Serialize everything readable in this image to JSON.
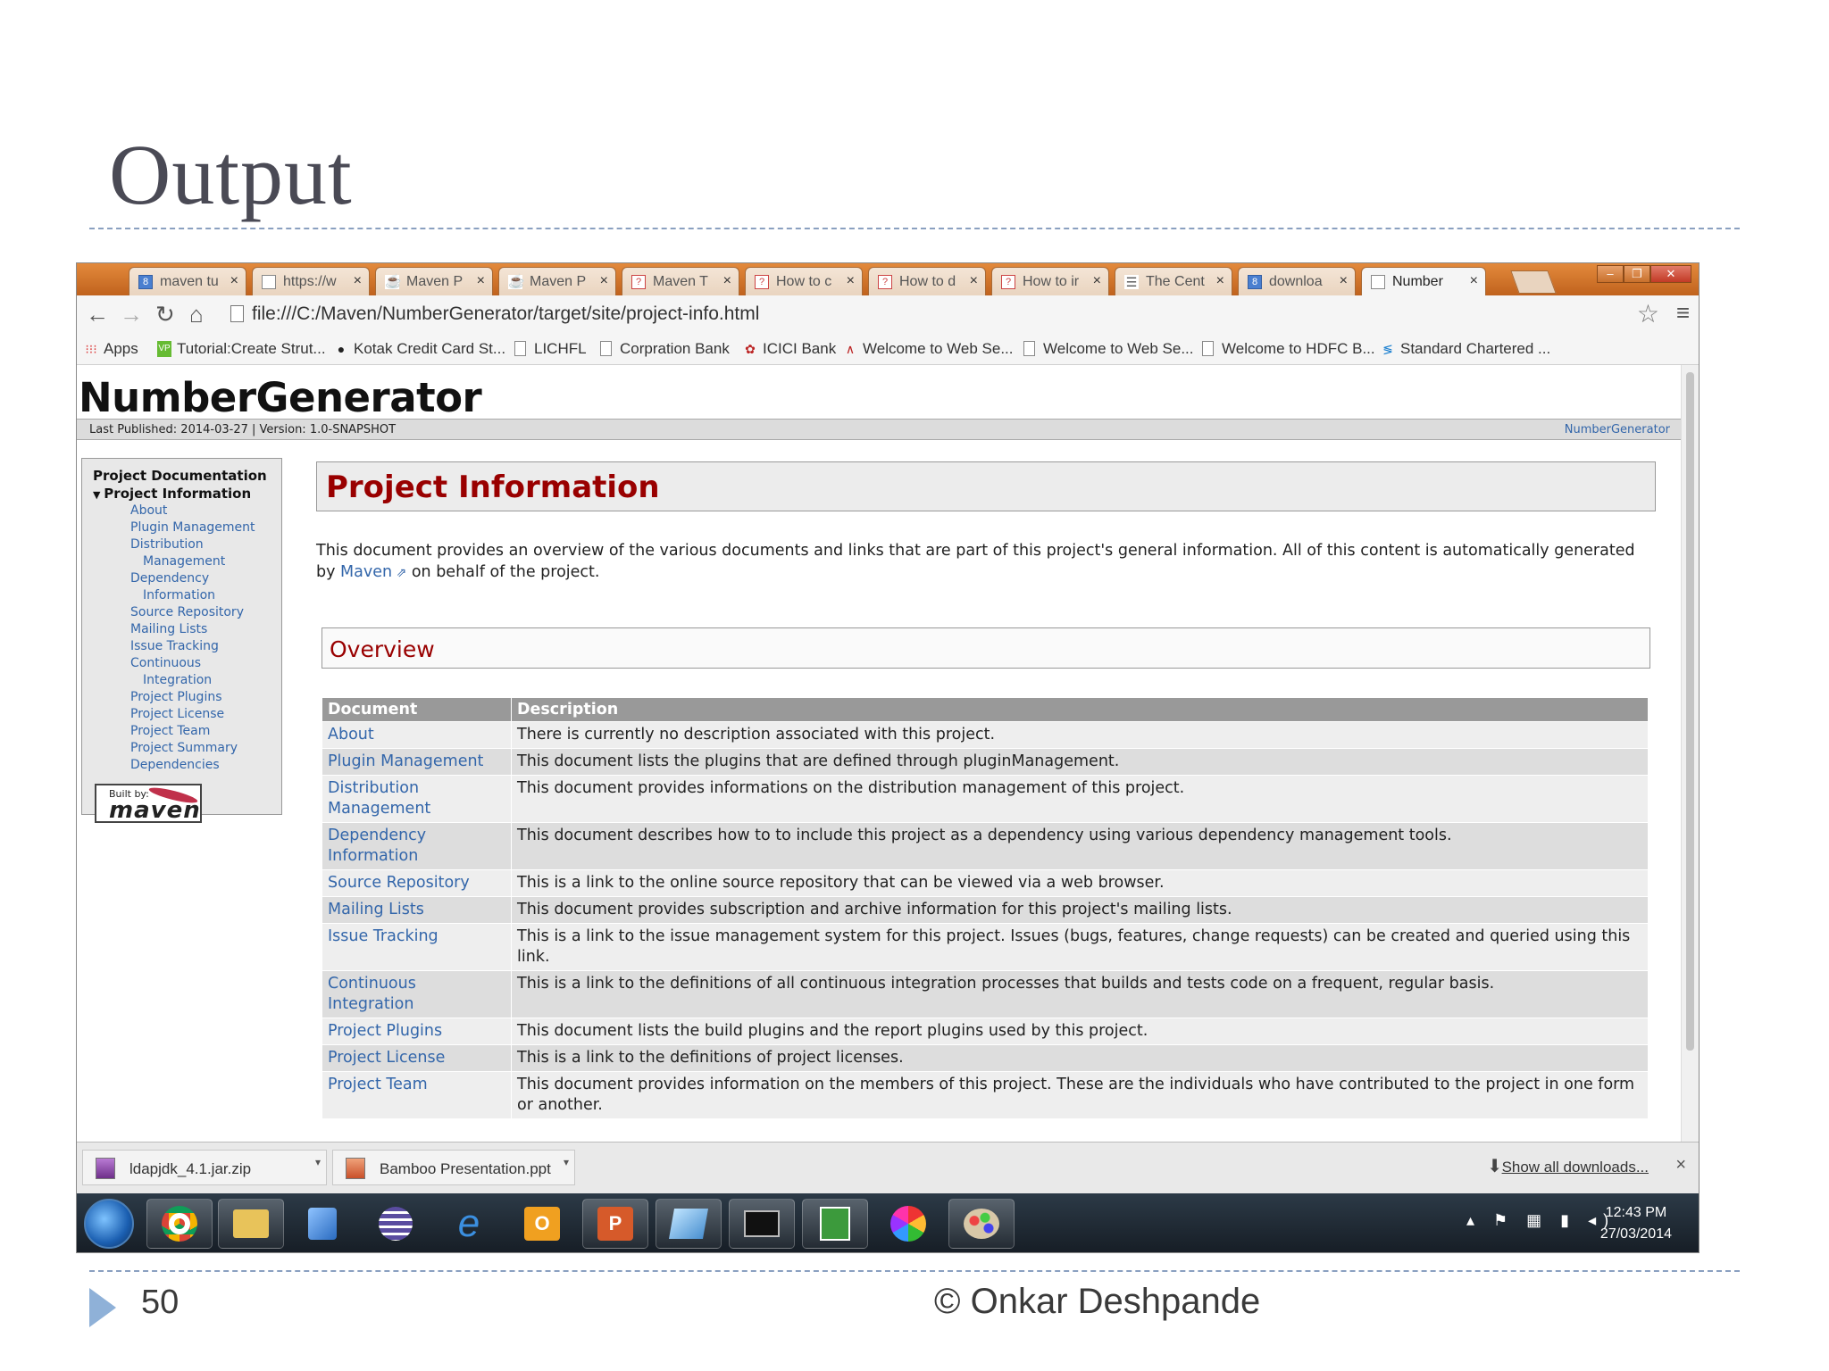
{
  "slide": {
    "title": "Output",
    "page_number": "50",
    "credit": "© Onkar Deshpande"
  },
  "browser": {
    "tabs": [
      {
        "label": "maven tu",
        "icon": "google-icon"
      },
      {
        "label": "https://w",
        "icon": "page-icon"
      },
      {
        "label": "Maven P",
        "icon": "java-icon"
      },
      {
        "label": "Maven P",
        "icon": "java-icon"
      },
      {
        "label": "Maven T",
        "icon": "question-icon"
      },
      {
        "label": "How to c",
        "icon": "question-icon"
      },
      {
        "label": "How to d",
        "icon": "question-icon"
      },
      {
        "label": "How to ir",
        "icon": "question-icon"
      },
      {
        "label": "The Cent",
        "icon": "list-icon"
      },
      {
        "label": "downloa",
        "icon": "google-icon"
      },
      {
        "label": "Number",
        "icon": "page-icon",
        "active": true
      }
    ],
    "address": "file:///C:/Maven/NumberGenerator/target/site/project-info.html",
    "bookmarks": [
      {
        "label": "Apps",
        "icon": "apps-icon"
      },
      {
        "label": "Tutorial:Create Strut...",
        "icon": "vp-icon"
      },
      {
        "label": "Kotak Credit Card St...",
        "icon": "kotak-icon"
      },
      {
        "label": "LICHFL",
        "icon": "page-icon"
      },
      {
        "label": "Corpration Bank",
        "icon": "page-icon"
      },
      {
        "label": "ICICI Bank",
        "icon": "icici-icon"
      },
      {
        "label": "Welcome to Web Se...",
        "icon": "arch-icon"
      },
      {
        "label": "Welcome to Web Se...",
        "icon": "page-icon"
      },
      {
        "label": "Welcome to HDFC B...",
        "icon": "page-icon"
      },
      {
        "label": "Standard Chartered ...",
        "icon": "sc-icon"
      }
    ]
  },
  "site": {
    "name": "NumberGenerator",
    "published": "Last Published: 2014-03-27  | Version: 1.0-SNAPSHOT",
    "breadcrumb_right": "NumberGenerator",
    "menu_heading": "Project Documentation",
    "menu_sub": "Project Information",
    "menu_items": [
      "About",
      "Plugin Management",
      "Distribution",
      "Management",
      "Dependency",
      "Information",
      "Source Repository",
      "Mailing Lists",
      "Issue Tracking",
      "Continuous",
      "Integration",
      "Project Plugins",
      "Project License",
      "Project Team",
      "Project Summary",
      "Dependencies"
    ],
    "built_by_small": "Built by:",
    "built_by_word": "maven",
    "heading": "Project Information",
    "intro_before": "This document provides an overview of the various documents and links that are part of this project's general information. All of this content is automatically generated by ",
    "intro_link": "Maven",
    "intro_after": " on behalf of the project.",
    "overview": "Overview",
    "table_headers": [
      "Document",
      "Description"
    ],
    "table_rows": [
      {
        "doc": "About",
        "desc": "There is currently no description associated with this project."
      },
      {
        "doc": "Plugin Management",
        "desc": "This document lists the plugins that are defined through pluginManagement."
      },
      {
        "doc": "Distribution Management",
        "desc": "This document provides informations on the distribution management of this project."
      },
      {
        "doc": "Dependency Information",
        "desc": "This document describes how to to include this project as a dependency using various dependency management tools."
      },
      {
        "doc": "Source Repository",
        "desc": "This is a link to the online source repository that can be viewed via a web browser."
      },
      {
        "doc": "Mailing Lists",
        "desc": "This document provides subscription and archive information for this project's mailing lists."
      },
      {
        "doc": "Issue Tracking",
        "desc": "This is a link to the issue management system for this project. Issues (bugs, features, change requests) can be created and queried using this link."
      },
      {
        "doc": "Continuous Integration",
        "desc": "This is a link to the definitions of all continuous integration processes that builds and tests code on a frequent, regular basis."
      },
      {
        "doc": "Project Plugins",
        "desc": "This document lists the build plugins and the report plugins used by this project."
      },
      {
        "doc": "Project License",
        "desc": "This is a link to the definitions of project licenses."
      },
      {
        "doc": "Project Team",
        "desc": "This document provides information on the members of this project. These are the individuals who have contributed to the project in one form or another."
      }
    ]
  },
  "downloads": {
    "items": [
      "ldapjdk_4.1.jar.zip",
      "Bamboo Presentation.ppt"
    ],
    "show_all": "Show all downloads..."
  },
  "taskbar": {
    "time": "12:43 PM",
    "date": "27/03/2014"
  },
  "colors": {
    "tab_strip": "#d9782e",
    "heading_red": "#990000",
    "link_blue": "#3366aa",
    "table_header": "#999999"
  }
}
